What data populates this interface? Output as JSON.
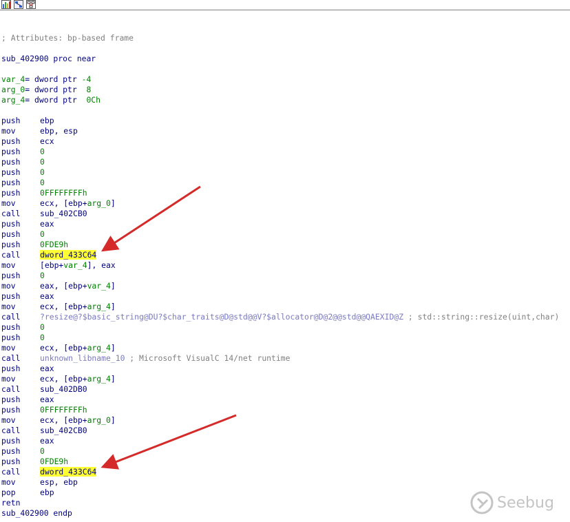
{
  "toolbar": {
    "buttons": [
      {
        "name": "graph-view-icon"
      },
      {
        "name": "flowchart-icon"
      },
      {
        "name": "proximity-view-icon"
      }
    ]
  },
  "listing": {
    "attr_comment": "; Attributes: bp-based frame",
    "proc_start": "sub_402900 proc near",
    "vars": [
      {
        "name": "var_4",
        "decl": "= dword ptr ",
        "value": "-4"
      },
      {
        "name": "arg_0",
        "decl": "= dword ptr  ",
        "value": "8"
      },
      {
        "name": "arg_4",
        "decl": "= dword ptr  ",
        "value": "0Ch"
      }
    ],
    "instructions": [
      {
        "m": "push",
        "o": "ebp"
      },
      {
        "m": "mov",
        "o": "ebp, esp"
      },
      {
        "m": "push",
        "o": "ecx"
      },
      {
        "m": "push",
        "o": "0"
      },
      {
        "m": "push",
        "o": "0"
      },
      {
        "m": "push",
        "o": "0"
      },
      {
        "m": "push",
        "o": "0"
      },
      {
        "m": "push",
        "o": "0FFFFFFFFh"
      },
      {
        "m": "mov",
        "o": "ecx, [ebp+arg_0]"
      },
      {
        "m": "call",
        "o": "sub_402CB0"
      },
      {
        "m": "push",
        "o": "eax"
      },
      {
        "m": "push",
        "o": "0"
      },
      {
        "m": "push",
        "o": "0FDE9h"
      },
      {
        "m": "call",
        "o": "dword_433C64"
      },
      {
        "m": "mov",
        "o": "[ebp+var_4], eax"
      },
      {
        "m": "push",
        "o": "0"
      },
      {
        "m": "mov",
        "o": "eax, [ebp+var_4]"
      },
      {
        "m": "push",
        "o": "eax"
      },
      {
        "m": "mov",
        "o": "ecx, [ebp+arg_4]"
      },
      {
        "m": "call",
        "o": "?resize@?$basic_string@DU?$char_traits@D@std@@V?$allocator@D@2@@std@@QAEXID@Z",
        "c": " ; std::string::resize(uint,char)"
      },
      {
        "m": "push",
        "o": "0"
      },
      {
        "m": "push",
        "o": "0"
      },
      {
        "m": "mov",
        "o": "ecx, [ebp+arg_4]"
      },
      {
        "m": "call",
        "o": "unknown_libname_10",
        "c": " ; Microsoft VisualC 14/net runtime"
      },
      {
        "m": "push",
        "o": "eax"
      },
      {
        "m": "mov",
        "o": "ecx, [ebp+arg_4]"
      },
      {
        "m": "call",
        "o": "sub_402DB0"
      },
      {
        "m": "push",
        "o": "eax"
      },
      {
        "m": "push",
        "o": "0FFFFFFFFh"
      },
      {
        "m": "mov",
        "o": "ecx, [ebp+arg_0]"
      },
      {
        "m": "call",
        "o": "sub_402CB0"
      },
      {
        "m": "push",
        "o": "eax"
      },
      {
        "m": "push",
        "o": "0"
      },
      {
        "m": "push",
        "o": "0FDE9h"
      },
      {
        "m": "call",
        "o": "dword_433C64"
      },
      {
        "m": "mov",
        "o": "esp, ebp"
      },
      {
        "m": "pop",
        "o": "ebp"
      },
      {
        "m": "retn",
        "o": ""
      }
    ],
    "proc_end": "sub_402900 endp"
  },
  "highlight_color": "#ffff33",
  "arrow_color": "#d42a2a",
  "watermark": {
    "text": "Seebug",
    "icon": "seebug-logo-icon"
  }
}
